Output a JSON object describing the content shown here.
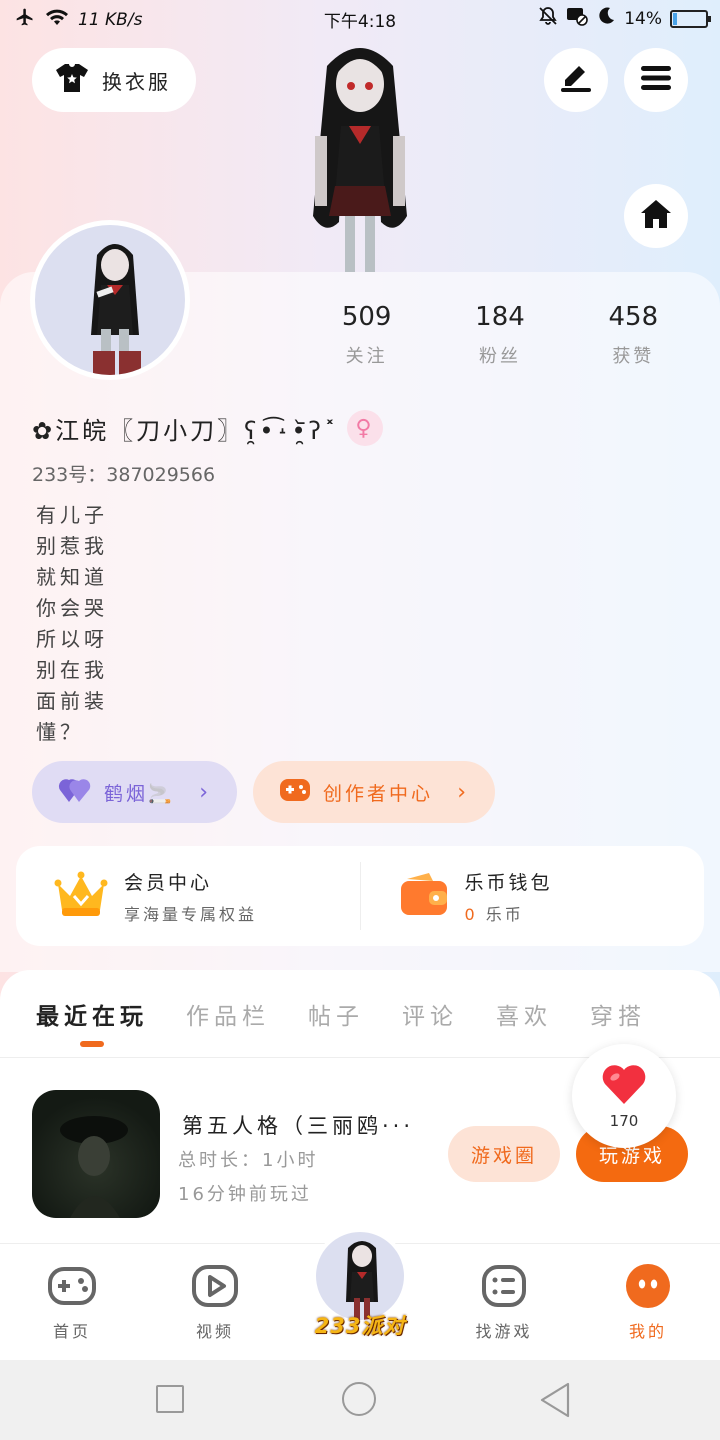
{
  "status_bar": {
    "net_speed": "11 KB/s",
    "time": "下午4:18",
    "battery_percent": "14%",
    "battery_level": 0.14
  },
  "header": {
    "outfit_button": "换衣服"
  },
  "profile": {
    "stats": [
      {
        "value": "509",
        "label": "关注"
      },
      {
        "value": "184",
        "label": "粉丝"
      },
      {
        "value": "458",
        "label": "获赞"
      }
    ],
    "username": "✿江皖〖刀小刀〗ʕ̯•͡˔•̯᷅ʔ˟",
    "user_id": "233号：387029566",
    "bio_lines": [
      "有儿子",
      "别惹我",
      "就知道",
      "你会哭",
      "所以呀",
      "别在我",
      "面前装",
      "懂？"
    ],
    "guild_chip": "鹤烟🚬",
    "creator_chip": "创作者中心"
  },
  "vip": {
    "member_title": "会员中心",
    "member_sub": "享海量专属权益",
    "wallet_title": "乐币钱包",
    "wallet_amount": "0",
    "wallet_unit": "乐币"
  },
  "tabs": [
    "最近在玩",
    "作品栏",
    "帖子",
    "评论",
    "喜欢",
    "穿搭"
  ],
  "game": {
    "title": "第五人格（三丽鸥···",
    "total_time": "总时长：1小时",
    "last_played": "16分钟前玩过",
    "circle_button": "游戏圈",
    "play_button": "玩游戏"
  },
  "like_count": "170",
  "bottom_nav": {
    "home": "首页",
    "video": "视频",
    "center": "233派对",
    "find": "找游戏",
    "mine": "我的"
  },
  "colors": {
    "accent": "#f06a1e",
    "guild": "#7b64d8"
  }
}
